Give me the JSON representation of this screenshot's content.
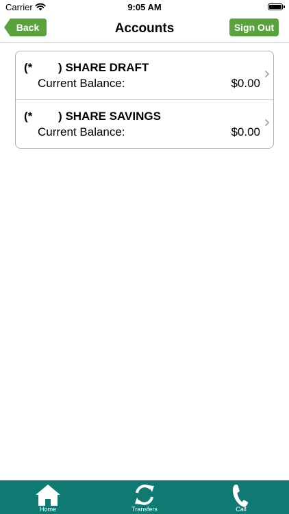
{
  "status_bar": {
    "carrier": "Carrier",
    "time": "9:05 AM",
    "battery_level": 1.0
  },
  "nav": {
    "title": "Accounts",
    "back_label": "Back",
    "signout_label": "Sign Out"
  },
  "accounts": [
    {
      "name": "(*        ) SHARE DRAFT",
      "balance_label": "Current Balance:",
      "balance": "$0.00"
    },
    {
      "name": "(*        ) SHARE SAVINGS",
      "balance_label": "Current Balance:",
      "balance": "$0.00"
    }
  ],
  "tab_bar": {
    "items": [
      {
        "label": "Home",
        "icon": "home-icon"
      },
      {
        "label": "Transfers",
        "icon": "transfers-icon"
      },
      {
        "label": "Call",
        "icon": "phone-icon"
      }
    ]
  },
  "colors": {
    "accent_green": "#5aa33c",
    "tab_bar_teal": "#0f7a72"
  }
}
